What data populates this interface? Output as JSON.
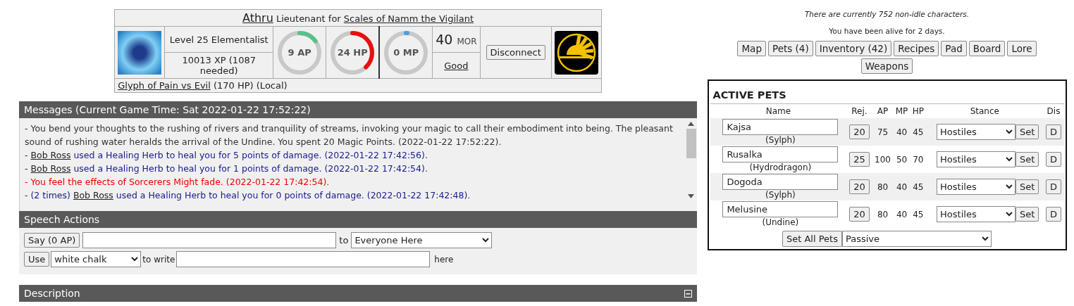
{
  "character": {
    "name": "Athru",
    "rank": "Lieutenant for",
    "faction": "Scales of Namm the Vigilant",
    "level_class": "Level 25 Elementalist",
    "xp": "10013 XP (1087 needed)",
    "gauges": [
      {
        "label": "9 AP",
        "level": 0.15,
        "color": "#5bbf8a"
      },
      {
        "label": "24 HP",
        "level": 0.38,
        "color": "#e81010"
      },
      {
        "label": "0 MP",
        "level": 0.01,
        "color": "#4a9ee0"
      }
    ],
    "morale": {
      "value": "40",
      "unit": "MOR",
      "status": "Good"
    },
    "disconnect": "Disconnect",
    "effect": {
      "name": "Glyph of Pain vs Evil",
      "detail": "(170 HP) (Local)"
    }
  },
  "messages": {
    "title": "Messages (Current Game Time: Sat 2022-01-22 17:52:22)",
    "items": [
      {
        "kind": "plain",
        "before": "- You bend your thoughts to the rushing of rivers and tranquility of streams, invoking your magic to call their embodiment into being. The pleasant sound of rushing water heralds the arrival of the Undine. You spent 20 Magic Points. (2022-01-22 17:52:22)."
      },
      {
        "kind": "heal",
        "before": "- ",
        "link": "Bob Ross",
        "after": " used a Healing Herb to heal you for 5 points of damage. (2022-01-22 17:42:56)."
      },
      {
        "kind": "heal",
        "before": "- ",
        "link": "Bob Ross",
        "after": " used a Healing Herb to heal you for 1 points of damage. (2022-01-22 17:42:54)."
      },
      {
        "kind": "alert",
        "before": "- You feel the effects of Sorcerers Might fade. (2022-01-22 17:42:54)."
      },
      {
        "kind": "heal",
        "before": "- (2 times) ",
        "link": "Bob Ross",
        "after": " used a Healing Herb to heal you for 0 points of damage. (2022-01-22 17:42:48)."
      }
    ]
  },
  "speech": {
    "title": "Speech Actions",
    "say_button": "Say (0 AP)",
    "to": "to",
    "target": "Everyone Here",
    "use_button": "Use",
    "item": "white chalk",
    "to_write": "to write",
    "here": "here"
  },
  "description": {
    "title": "Description"
  },
  "status": [
    {
      "kind": "notice",
      "text": "There are currently 752 non-idle characters."
    },
    {
      "kind": "plain",
      "text": "You have been alive for 2 days."
    }
  ],
  "nav": [
    "Map",
    "Pets (4)",
    "Inventory (42)",
    "Recipes",
    "Pad",
    "Board",
    "Lore",
    "Weapons"
  ],
  "pets": {
    "title": "ACTIVE PETS",
    "columns": [
      "Name",
      "Rej.",
      "AP",
      "MP",
      "HP",
      "Stance",
      "Dis"
    ],
    "rows": [
      {
        "name": "Kajsa",
        "species": "(Sylph)",
        "rej": "20",
        "ap": "75",
        "mp": "40",
        "hp": "45",
        "stance": "Hostiles",
        "set": "Set",
        "dis": "D"
      },
      {
        "name": "Rusalka",
        "species": "(Hydrodragon)",
        "rej": "25",
        "ap": "100",
        "mp": "50",
        "hp": "70",
        "stance": "Hostiles",
        "set": "Set",
        "dis": "D"
      },
      {
        "name": "Dogoda",
        "species": "(Sylph)",
        "rej": "20",
        "ap": "80",
        "mp": "40",
        "hp": "45",
        "stance": "Hostiles",
        "set": "Set",
        "dis": "D"
      },
      {
        "name": "Melusine",
        "species": "(Undine)",
        "rej": "20",
        "ap": "80",
        "mp": "40",
        "hp": "45",
        "stance": "Hostiles",
        "set": "Set",
        "dis": "D"
      }
    ],
    "set_all": "Set All Pets",
    "all_stance": "Passive"
  }
}
